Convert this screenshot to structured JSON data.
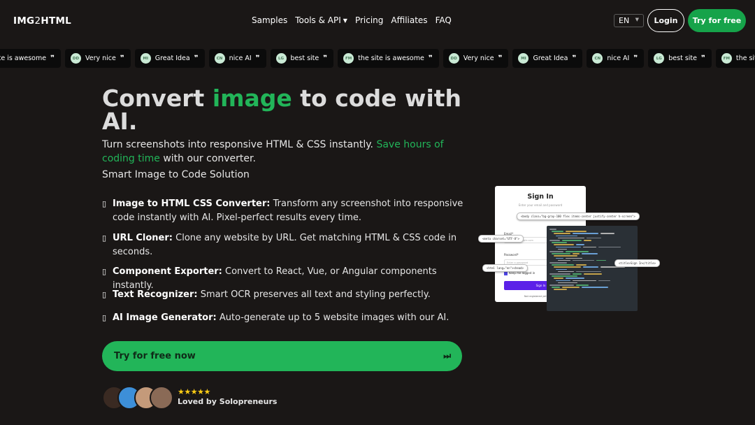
{
  "header": {
    "logo": {
      "part1": "IMG",
      "part2": "2",
      "part3": "HTML"
    },
    "nav": [
      {
        "label": "Samples"
      },
      {
        "label": "Tools & API",
        "has_dropdown": true
      },
      {
        "label": "Pricing"
      },
      {
        "label": "Affiliates"
      },
      {
        "label": "FAQ"
      }
    ],
    "language": "EN",
    "login_label": "Login",
    "try_label": "Try for free"
  },
  "testimonials": [
    {
      "initials": "",
      "text": "site is awesome"
    },
    {
      "initials": "DD",
      "text": "Very nice"
    },
    {
      "initials": "MI",
      "text": "Great Idea"
    },
    {
      "initials": "CN",
      "text": "nice AI"
    },
    {
      "initials": "LG",
      "text": "best site"
    },
    {
      "initials": "FM",
      "text": "the site is awesome"
    },
    {
      "initials": "DD",
      "text": "Very nice"
    },
    {
      "initials": "MI",
      "text": "Great Idea"
    },
    {
      "initials": "CN",
      "text": "nice AI"
    },
    {
      "initials": "LG",
      "text": "best site"
    },
    {
      "initials": "FM",
      "text": "the site is awesome"
    }
  ],
  "hero": {
    "title_pre": "Convert ",
    "title_highlight": "image",
    "title_post": " to code with AI.",
    "subtitle_pre": "Turn screenshots into responsive HTML & CSS instantly. ",
    "subtitle_highlight": "Save hours of coding time",
    "subtitle_post": " with our converter.",
    "tagline": "Smart Image to Code Solution"
  },
  "features": [
    {
      "title": "Image to HTML CSS Converter:",
      "desc": " Transform any screenshot into responsive code instantly with AI. Pixel-perfect results every time."
    },
    {
      "title": "URL Cloner:",
      "desc": " Clone any website by URL. Get matching HTML & CSS code in seconds."
    },
    {
      "title": "Component Exporter:",
      "desc": " Convert to React, Vue, or Angular components instantly."
    },
    {
      "title": "Text Recognizer:",
      "desc": " Smart OCR preserves all text and styling perfectly."
    },
    {
      "title": "AI Image Generator:",
      "desc": " Auto-generate up to 5 website images with our AI."
    }
  ],
  "cta": {
    "label": "Try for free now"
  },
  "social_proof": {
    "rating": 5,
    "stars": "★★★★★",
    "label": "Loved by Solopreneurs"
  },
  "illustration": {
    "card_title": "Sign In",
    "card_subtitle": "Enter your email and password",
    "email_label": "Email*",
    "email_placeholder": "mail@simmmple.com",
    "password_label": "Password*",
    "password_placeholder": "Enter a password",
    "keep_logged": "Keep me logged in",
    "button": "Sign In",
    "footer": "Not registered yet? Create",
    "tag1": "<body class=\"bg-gray-100 flex items-center justify-center h-screen\">",
    "tag2": "<meta charset=\"UTF-8\">",
    "tag3": "<html lang=\"en\"><head>",
    "tag4": "<title>Sign In</title>"
  },
  "colors": {
    "background": "#1a1716",
    "accent_green": "#22b559",
    "button_green": "#16a34a",
    "star_yellow": "#facc15"
  }
}
